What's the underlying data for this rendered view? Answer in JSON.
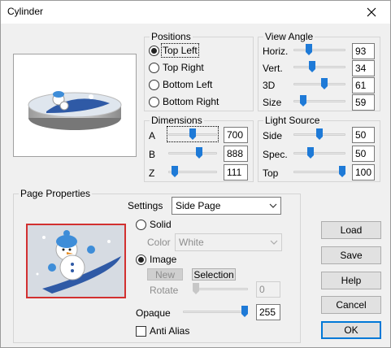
{
  "window": {
    "title": "Cylinder"
  },
  "positions": {
    "label": "Positions",
    "options": [
      {
        "label": "Top Left",
        "checked": true
      },
      {
        "label": "Top Right",
        "checked": false
      },
      {
        "label": "Bottom Left",
        "checked": false
      },
      {
        "label": "Bottom Right",
        "checked": false
      }
    ]
  },
  "view_angle": {
    "label": "View Angle",
    "rows": [
      {
        "label": "Horiz.",
        "value": "93",
        "level": 0.26
      },
      {
        "label": "Vert.",
        "value": "34",
        "level": 0.34
      },
      {
        "label": "3D",
        "value": "61",
        "level": 0.61
      },
      {
        "label": "Size",
        "value": "59",
        "level": 0.15
      }
    ]
  },
  "dimensions": {
    "label": "Dimensions",
    "rows": [
      {
        "label": "A",
        "value": "700",
        "level": 0.5
      },
      {
        "label": "B",
        "value": "888",
        "level": 0.65
      },
      {
        "label": "Z",
        "value": "111",
        "level": 0.08
      }
    ]
  },
  "light_source": {
    "label": "Light Source",
    "rows": [
      {
        "label": "Side",
        "value": "50",
        "level": 0.5
      },
      {
        "label": "Spec.",
        "value": "50",
        "level": 0.3
      },
      {
        "label": "Top",
        "value": "100",
        "level": 1.0
      }
    ]
  },
  "page_properties": {
    "label": "Page Properties",
    "settings_label": "Settings",
    "settings_value": "Side Page",
    "solid_label": "Solid",
    "color_label": "Color",
    "color_value": "White",
    "image_label": "Image",
    "new_label": "New",
    "selection_label": "Selection",
    "rotate_label": "Rotate",
    "rotate_value": "0",
    "opaque_label": "Opaque",
    "opaque_value": "255",
    "opaque_level": 1.0,
    "anti_alias_label": "Anti Alias"
  },
  "buttons": {
    "load": "Load",
    "save": "Save",
    "help": "Help",
    "cancel": "Cancel",
    "ok": "OK"
  },
  "colors": {
    "accent": "#1e7ad7",
    "snowboard": "#2f5aa6",
    "thumb_border": "#d23030"
  }
}
